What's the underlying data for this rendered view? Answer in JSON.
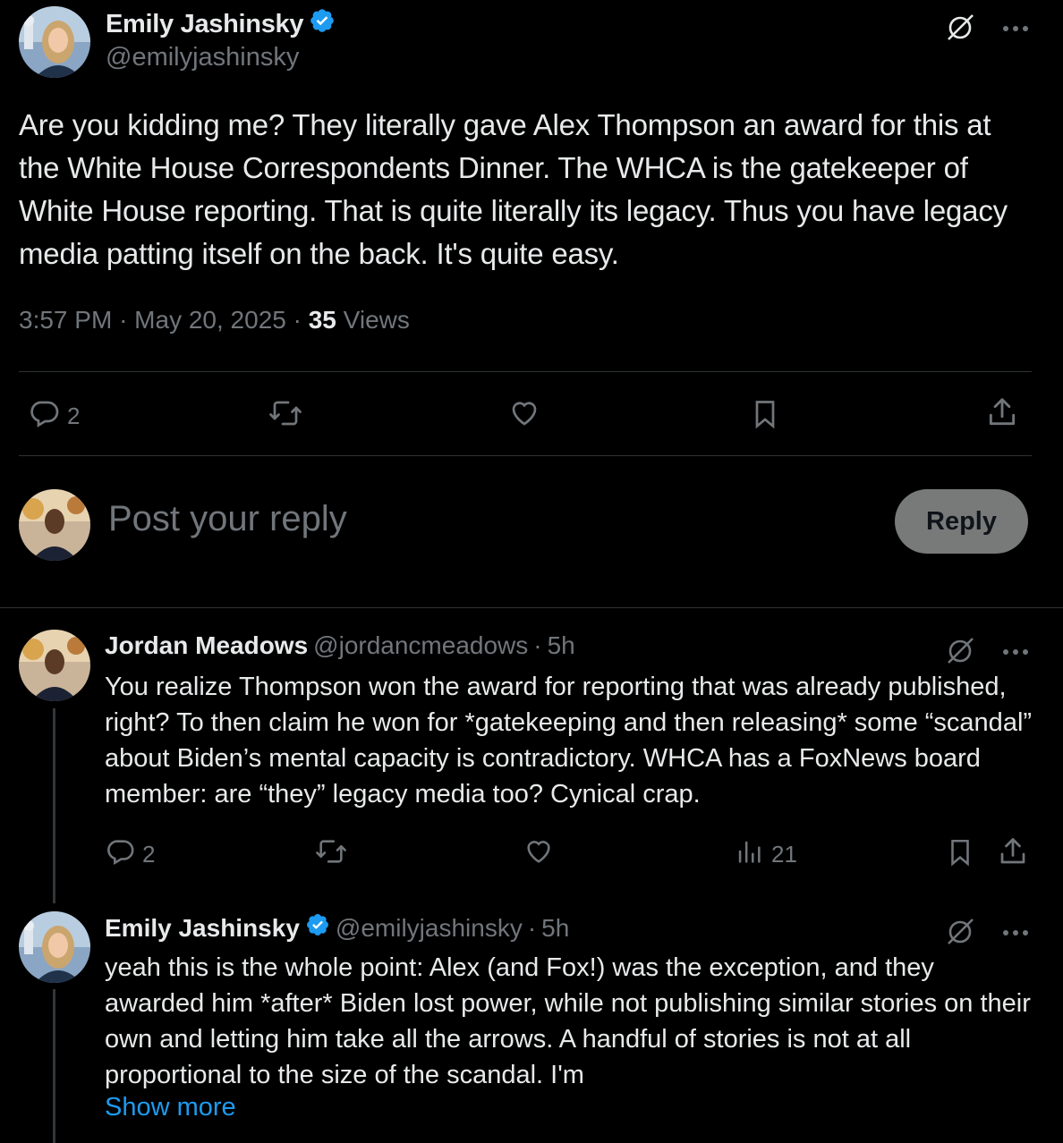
{
  "main_tweet": {
    "author_name": "Emily Jashinsky",
    "handle": "@emilyjashinsky",
    "text": "Are you kidding me? They literally gave Alex Thompson an award for this at the White House Correspondents Dinner. The WHCA is the gatekeeper of White House reporting. That is quite literally its legacy. Thus you have legacy media patting itself on the back. It's quite easy.",
    "time": "3:57 PM",
    "date": "May 20, 2025",
    "views_count": "35",
    "views_label": "Views",
    "reply_count": "2"
  },
  "composer": {
    "placeholder": "Post your reply",
    "reply_label": "Reply"
  },
  "replies": [
    {
      "author_name": "Jordan Meadows",
      "handle": "@jordancmeadows",
      "time_ago": "5h",
      "text": "You realize Thompson won the award for reporting that was already published, right? To then claim he won for *gatekeeping and then releasing* some “scandal” about Biden’s mental capacity is contradictory. WHCA has a FoxNews board member: are “they” legacy media too? Cynical crap.",
      "reply_count": "2",
      "views_count": "21"
    },
    {
      "author_name": "Emily Jashinsky",
      "handle": "@emilyjashinsky",
      "time_ago": "5h",
      "text": "yeah this is the whole point: Alex (and Fox!) was the exception, and they awarded him *after* Biden lost power, while not publishing similar stories on their own and letting him take all the arrows. A handful of stories is not at all proportional to the size of the scandal. I'm",
      "show_more": "Show more"
    }
  ],
  "separator": "·",
  "colors": {
    "background": "#000000",
    "text": "#e7e9ea",
    "muted": "#71767b",
    "verified": "#1d9bf0",
    "link": "#1d9bf0",
    "divider": "#2f3336"
  },
  "icons": [
    "verified-badge-icon",
    "grok-icon",
    "more-icon",
    "reply-icon",
    "repost-icon",
    "like-icon",
    "bookmark-icon",
    "share-icon",
    "views-icon"
  ]
}
